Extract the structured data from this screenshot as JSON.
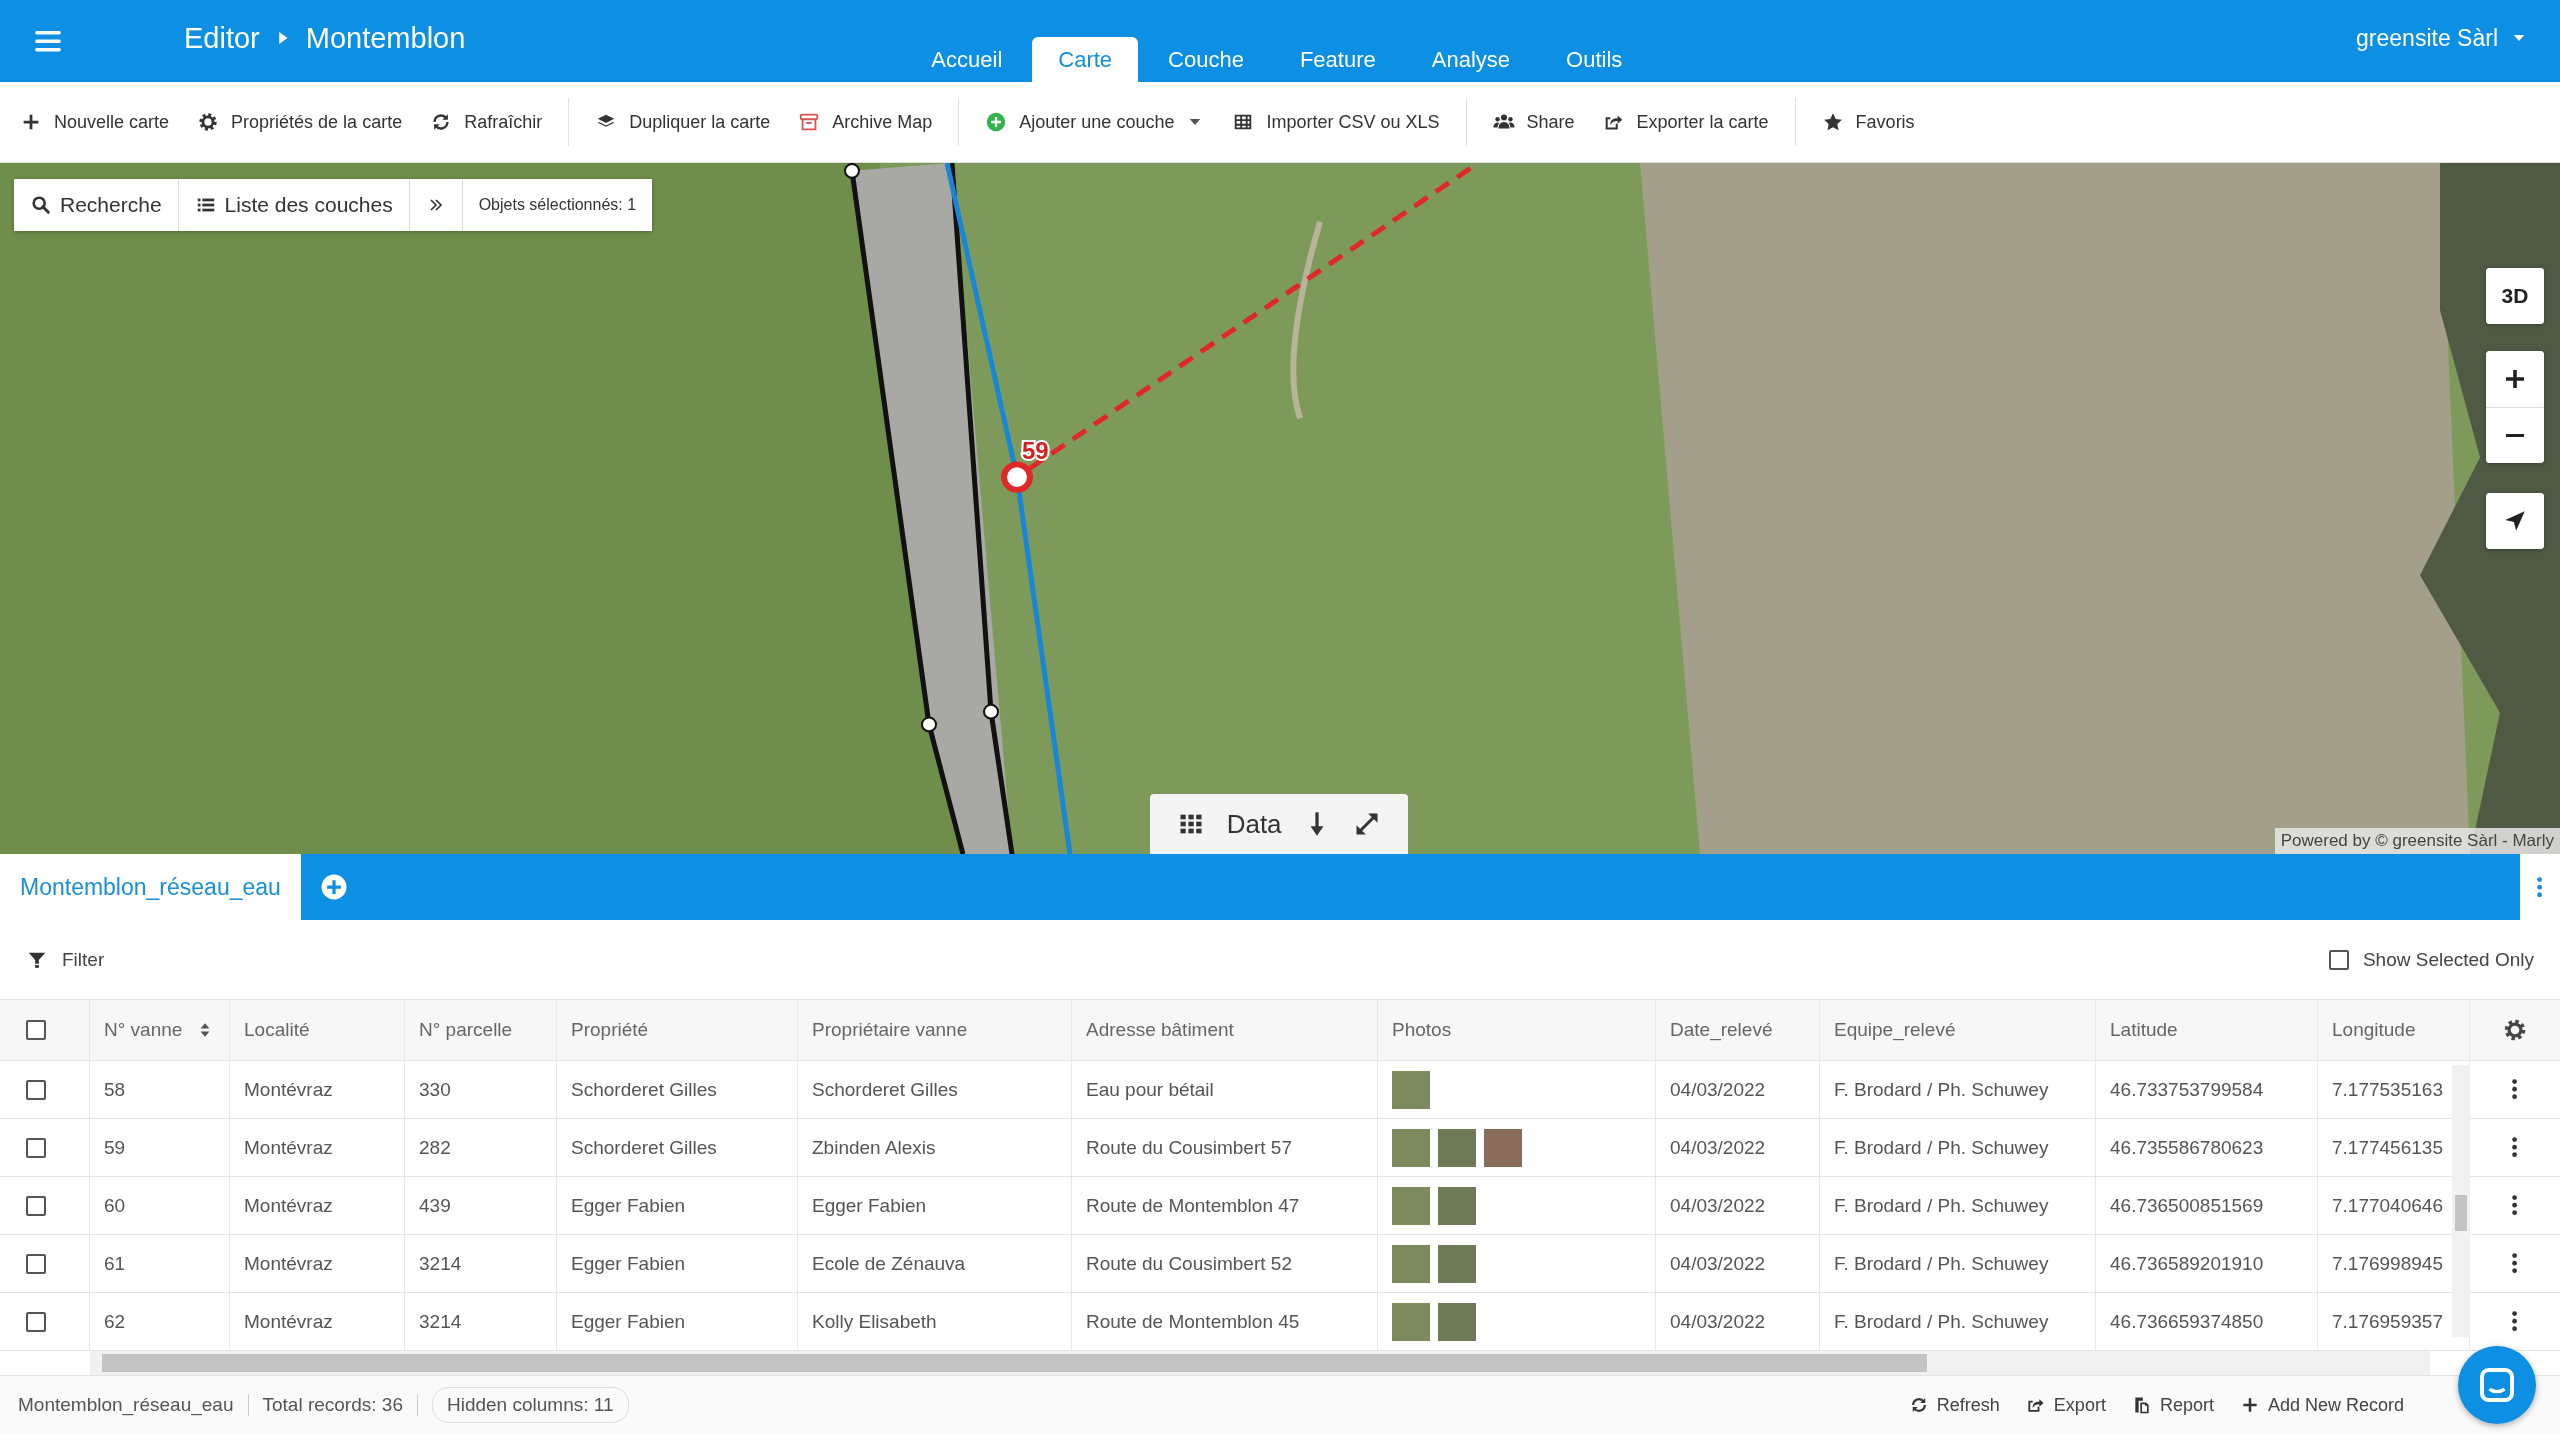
{
  "header": {
    "menu": true,
    "breadcrumb": [
      "Editor",
      "Montemblon"
    ],
    "tabs": [
      {
        "label": "Accueil",
        "selected": false
      },
      {
        "label": "Carte",
        "selected": true
      },
      {
        "label": "Couche",
        "selected": false
      },
      {
        "label": "Feature",
        "selected": false
      },
      {
        "label": "Analyse",
        "selected": false
      },
      {
        "label": "Outils",
        "selected": false
      }
    ],
    "user": "greensite Sàrl"
  },
  "toolbar": [
    [
      {
        "label": "Nouvelle carte",
        "dropdown": false
      },
      {
        "label": "Propriétés de la carte",
        "dropdown": false
      },
      {
        "label": "Rafraîchir",
        "dropdown": false
      }
    ],
    [
      {
        "label": "Dupliquer la carte",
        "dropdown": false
      },
      {
        "label": "Archive Map",
        "dropdown": false
      }
    ],
    [
      {
        "label": "Ajouter une couche",
        "dropdown": true
      },
      {
        "label": "Importer CSV ou XLS",
        "dropdown": false
      }
    ],
    [
      {
        "label": "Share",
        "dropdown": false
      },
      {
        "label": "Exporter la carte",
        "dropdown": false
      }
    ],
    [
      {
        "label": "Favoris",
        "dropdown": false
      }
    ]
  ],
  "map": {
    "search": "Recherche",
    "layers": "Liste des couches",
    "selection": "Objets sélectionnés: 1",
    "marker_label": "59",
    "view_button": "3D",
    "data_bar": "Data",
    "attribution": "Powered by © greensite Sàrl - Marly"
  },
  "data_panel": {
    "tabs": [
      {
        "label": "Montemblon_réseau_eau",
        "selected": true
      }
    ],
    "filter": "Filter",
    "show_selected_only": {
      "label": "Show Selected Only",
      "checked": false
    },
    "table": {
      "all_checked": false,
      "columns": [
        {
          "label": "N° vanne",
          "kind": "text",
          "sortable": true
        },
        {
          "label": "Localité",
          "kind": "text",
          "sortable": false
        },
        {
          "label": "N° parcelle",
          "kind": "text",
          "sortable": false
        },
        {
          "label": "Propriété",
          "kind": "text",
          "sortable": false
        },
        {
          "label": "Propriétaire vanne",
          "kind": "text",
          "sortable": false
        },
        {
          "label": "Adresse bâtiment",
          "kind": "text",
          "sortable": false
        },
        {
          "label": "Photos",
          "kind": "photos",
          "sortable": false
        },
        {
          "label": "Date_relevé",
          "kind": "text",
          "sortable": false
        },
        {
          "label": "Equipe_relevé",
          "kind": "text",
          "sortable": false
        },
        {
          "label": "Latitude",
          "kind": "text",
          "sortable": false
        },
        {
          "label": "Longitude",
          "kind": "text",
          "sortable": false
        }
      ],
      "rows": [
        {
          "checked": false,
          "values": [
            "58",
            "Montévraz",
            "330",
            "Schorderet Gilles",
            "Schorderet Gilles",
            "Eau pour bétail",
            "04/03/2022",
            "F. Brodard / Ph. Schuwey",
            "46.733753799584",
            "7.177535163"
          ],
          "photos": [
            {
              "kind": "photo"
            }
          ]
        },
        {
          "checked": false,
          "values": [
            "59",
            "Montévraz",
            "282",
            "Schorderet Gilles",
            "Zbinden Alexis",
            "Route du Cousimbert 57",
            "04/03/2022",
            "F. Brodard / Ph. Schuwey",
            "46.735586780623",
            "7.177456135"
          ],
          "photos": [
            {
              "kind": "photo"
            },
            {
              "kind": "photo"
            },
            {
              "kind": "photo"
            }
          ]
        },
        {
          "checked": false,
          "values": [
            "60",
            "Montévraz",
            "439",
            "Egger Fabien",
            "Egger Fabien",
            "Route de Montemblon 47",
            "04/03/2022",
            "F. Brodard / Ph. Schuwey",
            "46.736500851569",
            "7.177040646"
          ],
          "photos": [
            {
              "kind": "photo"
            },
            {
              "kind": "photo"
            }
          ]
        },
        {
          "checked": false,
          "values": [
            "61",
            "Montévraz",
            "3214",
            "Egger Fabien",
            "Ecole de Zénauva",
            "Route du Cousimbert 52",
            "04/03/2022",
            "F. Brodard / Ph. Schuwey",
            "46.736589201910",
            "7.176998945"
          ],
          "photos": [
            {
              "kind": "photo"
            },
            {
              "kind": "photo"
            }
          ]
        },
        {
          "checked": false,
          "values": [
            "62",
            "Montévraz",
            "3214",
            "Egger Fabien",
            "Kolly Elisabeth",
            "Route de Montemblon 45",
            "04/03/2022",
            "F. Brodard / Ph. Schuwey",
            "46.736659374850",
            "7.176959357"
          ],
          "photos": [
            {
              "kind": "photo"
            },
            {
              "kind": "photo"
            }
          ]
        }
      ]
    },
    "footer": {
      "layer": "Montemblon_réseau_eau",
      "total": "Total records: 36",
      "hidden": "Hidden columns: 11",
      "actions": [
        "Refresh",
        "Export",
        "Report",
        "Add New Record"
      ]
    }
  }
}
